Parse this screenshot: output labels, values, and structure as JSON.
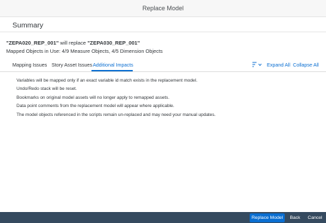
{
  "window": {
    "title": "Replace Model"
  },
  "summary": {
    "title": "Summary"
  },
  "replace_sentence": {
    "source": "\"ZEPA020_REP_001\"",
    "middle": " will replace ",
    "target": "\"ZEPA030_REP_001\""
  },
  "mapped_objects": "Mapped Objects in Use: 4/9 Measure Objects, 4/5 Dimension Objects",
  "tabs": [
    {
      "label": "Mapping Issues"
    },
    {
      "label": "Story Asset Issues"
    },
    {
      "label": "Additional Impacts",
      "active": true
    }
  ],
  "toolbar": {
    "sort_icon": "sort-icon",
    "expand_all": "Expand All",
    "collapse_all": "Collapse All"
  },
  "impacts": [
    "Variables will be mapped only if an exact variable id match exists in the replacement model.",
    "Undo/Redo stack will be reset.",
    "Bookmarks on original model assets will no longer apply to remapped assets.",
    "Data point comments from the replacement model will appear where applicable.",
    "The model objects referenced in the scripts remain un-replaced and may need your manual updates."
  ],
  "footer": {
    "replace_label": "Replace Model",
    "back_label": "Back",
    "cancel_label": "Cancel"
  },
  "colors": {
    "accent": "#0a6ed1",
    "footer_bg": "#354a5f",
    "titlebar_bg": "#f7f7f7"
  }
}
